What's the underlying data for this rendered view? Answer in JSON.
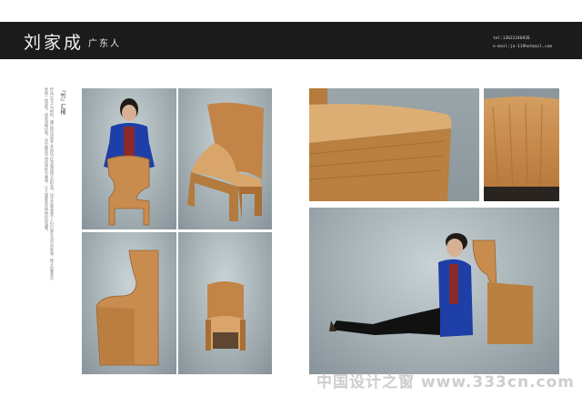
{
  "header": {
    "name": "刘家成",
    "region": "广东人",
    "phone": "tel:13622246926",
    "email": "e-mail:ja-119hotmail.com"
  },
  "sidebar": {
    "title": "『竹』汇椅",
    "description": "作品以竹子为材料，通过热压成型工艺把竹片弯曲成椅子的形态。设计灵感来源于人们日常生活中的坐姿，椅子的靠背与坐面一体成型，线条流畅自然，充分展现竹材的韧性与美感，让人感受到自然材料的温暖。"
  },
  "watermark": "中国设计之窗 www.333cn.com",
  "colors": {
    "header_bg": "#1b1b1b",
    "bamboo": "#c88c4e",
    "backdrop": "#9ba7ab"
  }
}
